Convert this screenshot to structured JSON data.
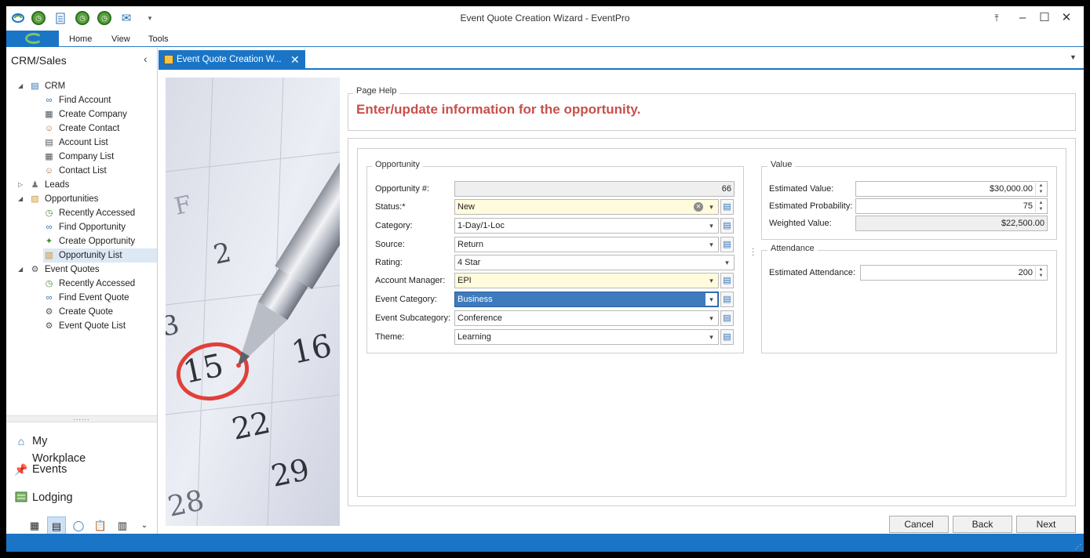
{
  "window": {
    "title": "Event Quote Creation Wizard - EventPro"
  },
  "menu": [
    "Home",
    "View",
    "Tools"
  ],
  "nav": {
    "title": "CRM/Sales",
    "tree": [
      {
        "label": "CRM",
        "level": 0,
        "icon": "crm-icon",
        "expanded": true
      },
      {
        "label": "Find Account",
        "level": 1,
        "icon": "binoculars-icon"
      },
      {
        "label": "Create Company",
        "level": 1,
        "icon": "create-company-icon"
      },
      {
        "label": "Create Contact",
        "level": 1,
        "icon": "create-contact-icon"
      },
      {
        "label": "Account List",
        "level": 1,
        "icon": "account-list-icon"
      },
      {
        "label": "Company List",
        "level": 1,
        "icon": "company-list-icon"
      },
      {
        "label": "Contact List",
        "level": 1,
        "icon": "contact-list-icon"
      },
      {
        "label": "Leads",
        "level": 0,
        "icon": "leads-icon",
        "expanded": false
      },
      {
        "label": "Opportunities",
        "level": 0,
        "icon": "opportunities-icon",
        "expanded": true
      },
      {
        "label": "Recently Accessed",
        "level": 1,
        "icon": "clock-icon"
      },
      {
        "label": "Find Opportunity",
        "level": 1,
        "icon": "binoculars-icon"
      },
      {
        "label": "Create Opportunity",
        "level": 1,
        "icon": "create-opportunity-icon"
      },
      {
        "label": "Opportunity List",
        "level": 1,
        "icon": "opportunity-list-icon",
        "selected": true
      },
      {
        "label": "Event Quotes",
        "level": 0,
        "icon": "event-quotes-icon",
        "expanded": true
      },
      {
        "label": "Recently Accessed",
        "level": 1,
        "icon": "clock-icon"
      },
      {
        "label": "Find Event Quote",
        "level": 1,
        "icon": "binoculars-icon"
      },
      {
        "label": "Create Quote",
        "level": 1,
        "icon": "create-quote-icon"
      },
      {
        "label": "Event Quote List",
        "level": 1,
        "icon": "event-quote-list-icon"
      }
    ],
    "sections": [
      {
        "label": "My Workplace",
        "icon": "home-icon"
      },
      {
        "label": "Events",
        "icon": "pushpin-icon"
      },
      {
        "label": "Lodging",
        "icon": "lodging-icon"
      }
    ]
  },
  "tab": {
    "label": "Event Quote Creation W..."
  },
  "page_help": {
    "title": "Page Help",
    "text": "Enter/update information for the opportunity."
  },
  "opportunity": {
    "title": "Opportunity",
    "fields": {
      "number": {
        "label": "Opportunity #:",
        "value": "66"
      },
      "status": {
        "label": "Status:*",
        "value": "New"
      },
      "category": {
        "label": "Category:",
        "value": "1-Day/1-Loc"
      },
      "source": {
        "label": "Source:",
        "value": "Return"
      },
      "rating": {
        "label": "Rating:",
        "value": "4 Star"
      },
      "account_manager": {
        "label": "Account Manager:",
        "value": "EPI"
      },
      "event_category": {
        "label": "Event Category:",
        "value": "Business"
      },
      "event_subcategory": {
        "label": "Event Subcategory:",
        "value": "Conference"
      },
      "theme": {
        "label": "Theme:",
        "value": "Learning"
      }
    }
  },
  "value": {
    "title": "Value",
    "estimated_value": {
      "label": "Estimated Value:",
      "value": "$30,000.00"
    },
    "estimated_probability": {
      "label": "Estimated Probability:",
      "value": "75"
    },
    "weighted_value": {
      "label": "Weighted Value:",
      "value": "$22,500.00"
    }
  },
  "attendance": {
    "title": "Attendance",
    "estimated_attendance": {
      "label": "Estimated Attendance:",
      "value": "200"
    }
  },
  "buttons": {
    "cancel": "Cancel",
    "back": "Back",
    "next": "Next"
  },
  "photo": {
    "calendar_numbers": [
      "2",
      "3",
      "15",
      "16",
      "22",
      "29",
      "28",
      "F"
    ]
  },
  "colors": {
    "accent": "#1a75c7",
    "help_text": "#c8504b",
    "required_field": "#fffbdc",
    "selected_field": "#3d7bbd"
  }
}
